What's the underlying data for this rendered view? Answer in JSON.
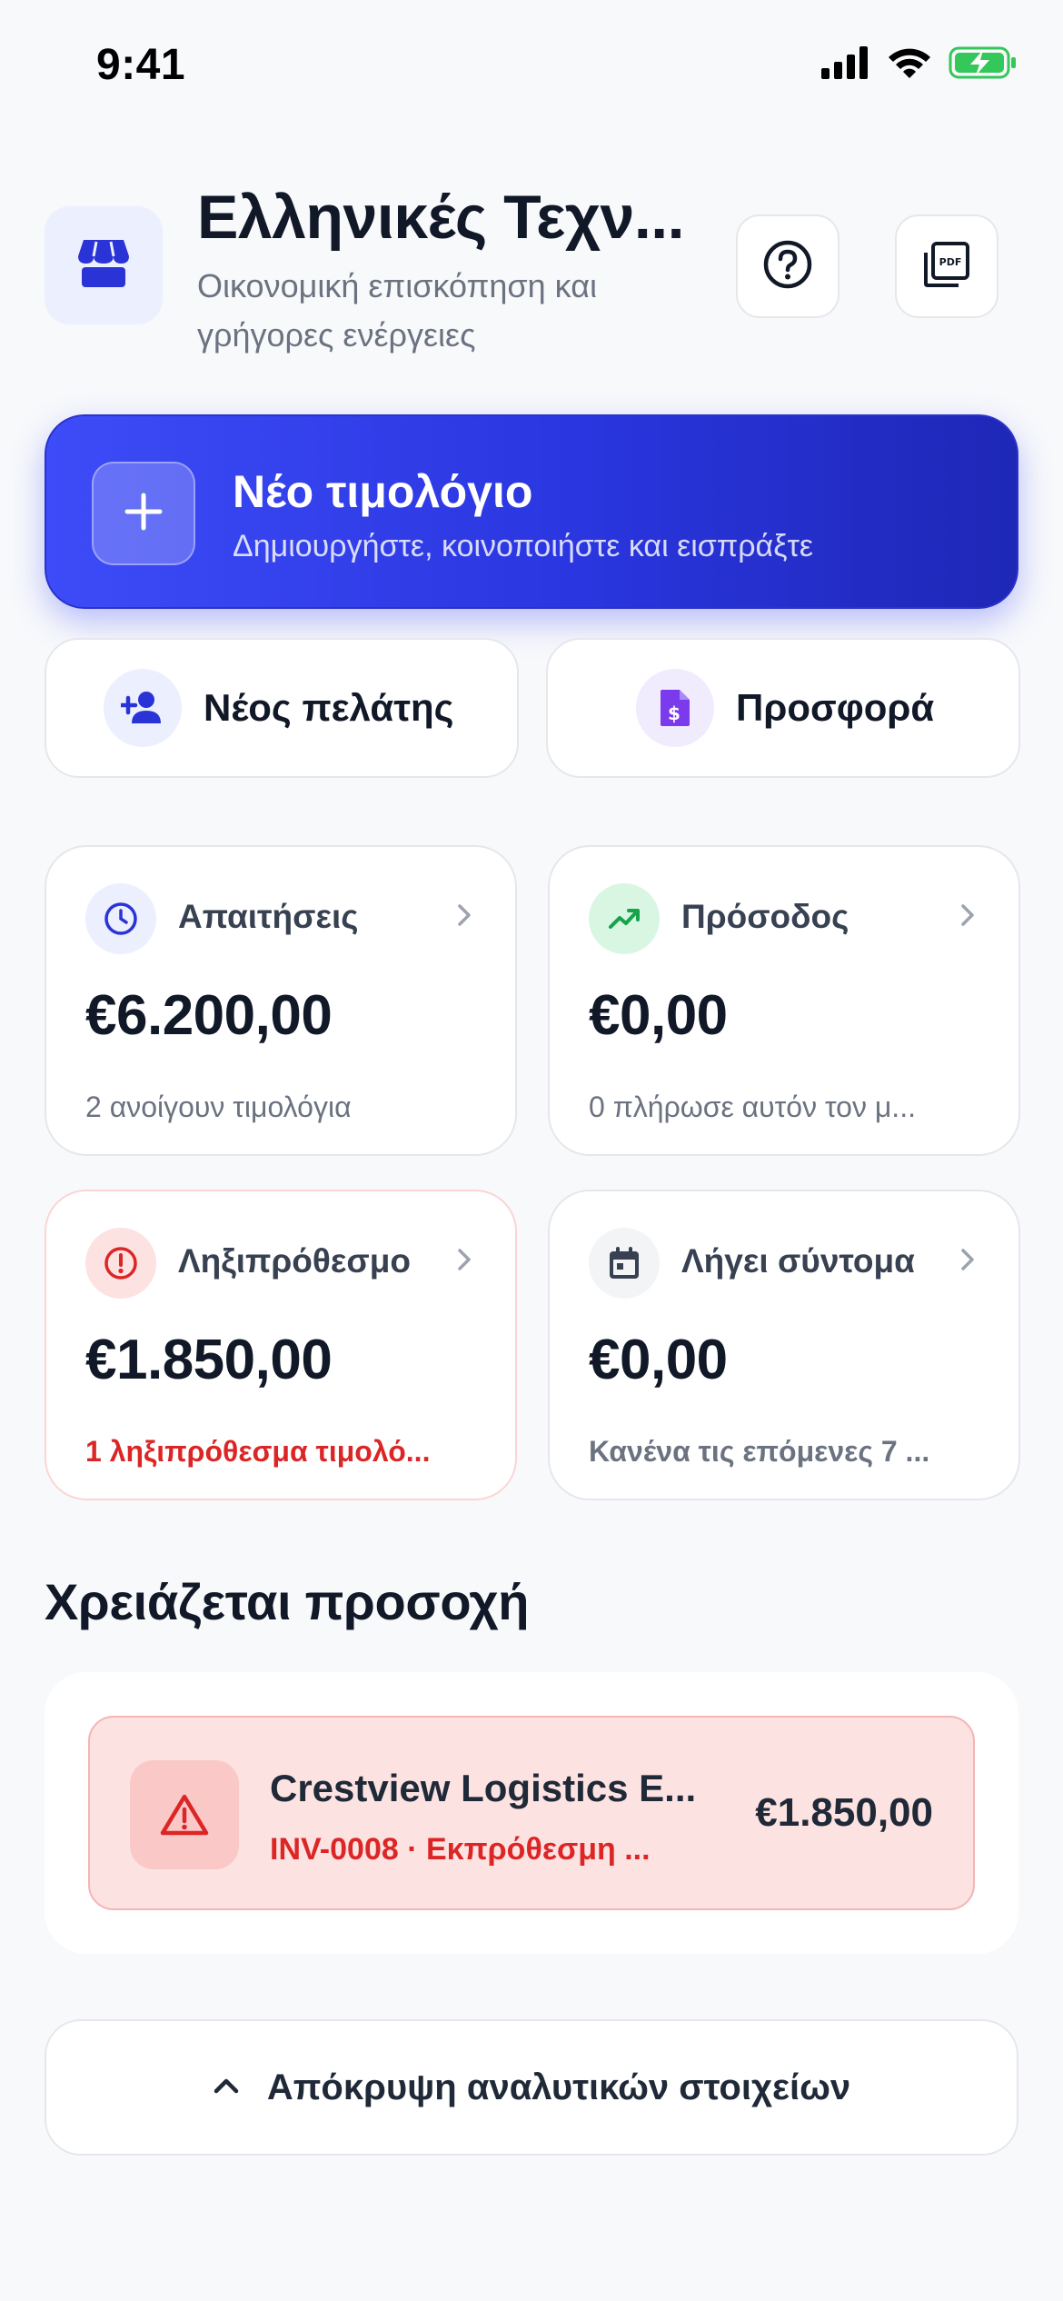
{
  "status_bar": {
    "time": "9:41"
  },
  "header": {
    "title": "Ελληνικές Τεχν...",
    "subtitle": "Οικονομική επισκόπηση και γρήγορες ενέργειες",
    "logo_icon": "storefront-icon",
    "help_icon": "help-circle-icon",
    "pdf_icon": "pdf-icon"
  },
  "primary_action": {
    "title": "Νέο τιμολόγιο",
    "subtitle": "Δημιουργήστε, κοινοποιήστε και εισπράξτε"
  },
  "secondary_actions": [
    {
      "label": "Νέος πελάτης",
      "icon": "person-add-icon"
    },
    {
      "label": "Προσφορά",
      "icon": "quote-document-icon"
    }
  ],
  "stats": [
    {
      "label": "Απαιτήσεις",
      "value": "€6.200,00",
      "desc": "2 ανοίγουν τιμολόγια",
      "icon": "clock-icon"
    },
    {
      "label": "Πρόσοδος",
      "value": "€0,00",
      "desc": "0 πλήρωσε αυτόν τον μ...",
      "icon": "trending-up-icon"
    },
    {
      "label": "Ληξιπρόθεσμο",
      "value": "€1.850,00",
      "desc": "1 ληξιπρόθεσμα τιμολό...",
      "icon": "alert-circle-icon"
    },
    {
      "label": "Λήγει σύντομα",
      "value": "€0,00",
      "desc": "Κανένα τις επόμενες 7 ...",
      "icon": "calendar-icon"
    }
  ],
  "attention": {
    "title": "Χρειάζεται προσοχή",
    "items": [
      {
        "name": "Crestview Logistics E...",
        "meta": "INV-0008 · Εκπρόθεσμη ...",
        "amount": "€1.850,00",
        "icon": "warning-triangle-icon"
      }
    ]
  },
  "toggle": {
    "label": "Απόκρυψη αναλυτικών στοιχείων",
    "icon": "chevron-up-icon"
  },
  "colors": {
    "accent": "#3d4cf8",
    "danger": "#dc2626",
    "success": "#16a34a",
    "purple": "#7c3aed",
    "background": "#f8f9fb"
  }
}
